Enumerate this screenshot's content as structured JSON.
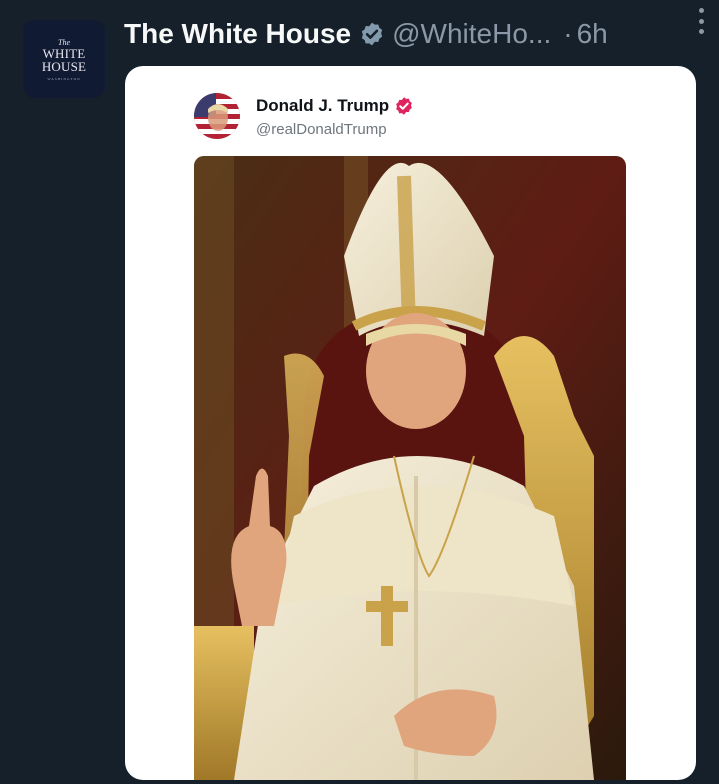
{
  "tweet": {
    "author": {
      "name": "The White House",
      "handle": "@WhiteHo...",
      "avatar_text": {
        "the": "The",
        "line1": "WHITE",
        "line2": "HOUSE",
        "sub": "WASHINGTON"
      }
    },
    "separator": "·",
    "time": "6h",
    "more_icon": "more-vertical-icon",
    "verified_badge_color": "#829aab"
  },
  "embedded_post": {
    "author": {
      "name": "Donald J. Trump",
      "handle": "@realDonaldTrump"
    },
    "verified_badge_color": "#e0245e",
    "image_description_icon": "photo-image"
  },
  "colors": {
    "background": "#15202b",
    "primary_text": "#f7f9f9",
    "secondary_text": "#8b98a5",
    "card_background": "#ffffff"
  }
}
